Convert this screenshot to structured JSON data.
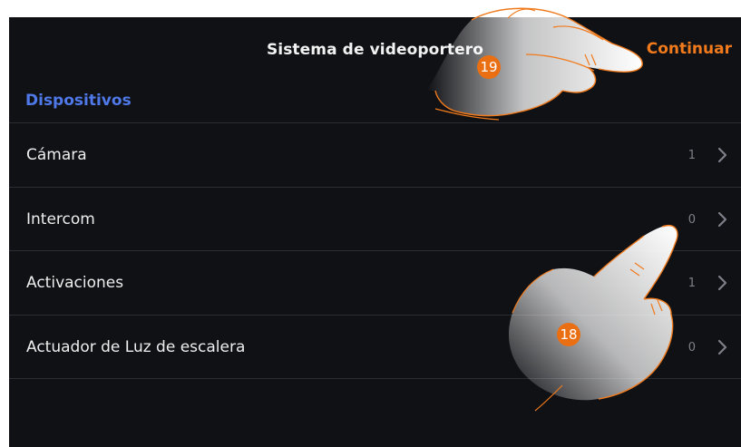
{
  "header": {
    "title": "Sistema de videoportero",
    "continue_label": "Continuar"
  },
  "section_title": "Dispositivos",
  "items": [
    {
      "label": "Cámara",
      "count": "1"
    },
    {
      "label": "Intercom",
      "count": "0"
    },
    {
      "label": "Activaciones",
      "count": "1"
    },
    {
      "label": "Actuador de Luz de escalera",
      "count": "0"
    }
  ],
  "callouts": {
    "continue_step": "19",
    "intercom_step": "18"
  },
  "colors": {
    "background": "#101115",
    "accent_orange": "#f07a1c",
    "section_blue": "#4f78e8",
    "badge_orange": "#ea6f12"
  },
  "icons": [
    "chevron-right-icon",
    "pointing-hand-icon"
  ]
}
